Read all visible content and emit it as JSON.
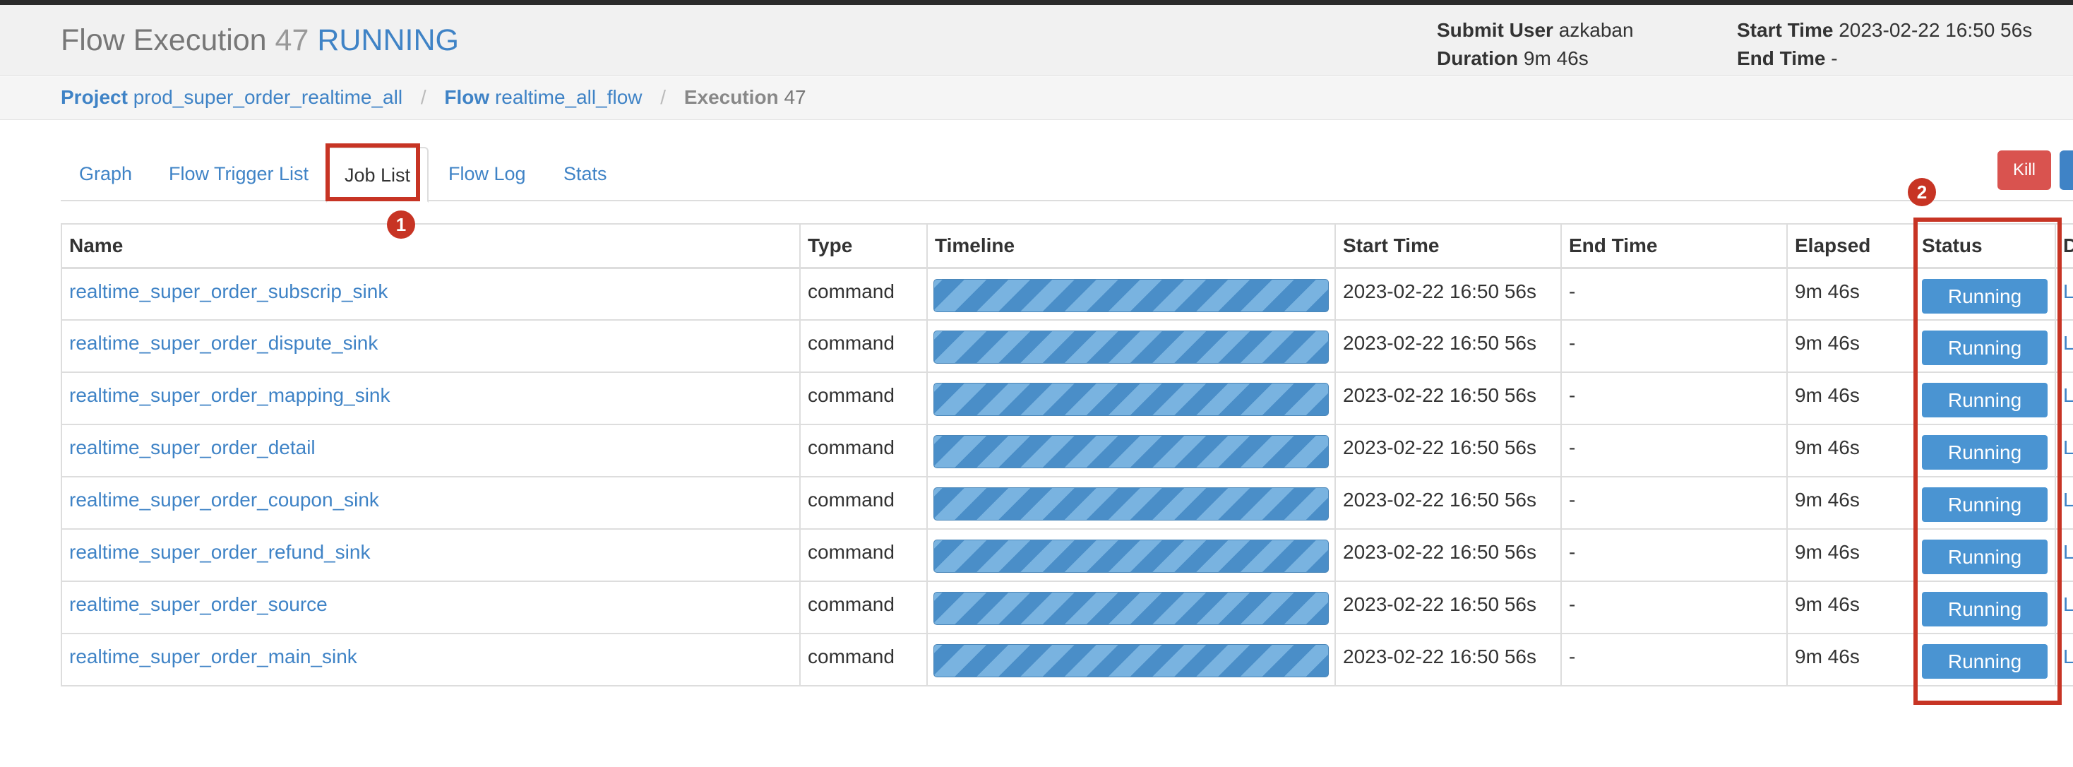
{
  "header": {
    "title": "Flow Execution",
    "exec_id": "47",
    "exec_status": "RUNNING",
    "submit_user_label": "Submit User",
    "submit_user": "azkaban",
    "duration_label": "Duration",
    "duration": "9m 46s",
    "start_time_label": "Start Time",
    "start_time": "2023-02-22 16:50 56s",
    "end_time_label": "End Time",
    "end_time": "-"
  },
  "breadcrumb": {
    "project_label": "Project",
    "project": "prod_super_order_realtime_all",
    "flow_label": "Flow",
    "flow": "realtime_all_flow",
    "execution_label": "Execution",
    "execution": "47"
  },
  "tabs": [
    {
      "label": "Graph"
    },
    {
      "label": "Flow Trigger List"
    },
    {
      "label": "Job List"
    },
    {
      "label": "Flow Log"
    },
    {
      "label": "Stats"
    }
  ],
  "active_tab": "Job List",
  "actions": {
    "kill_label": "Kill"
  },
  "annotations": {
    "first": "1",
    "second": "2"
  },
  "table": {
    "columns": [
      "Name",
      "Type",
      "Timeline",
      "Start Time",
      "End Time",
      "Elapsed",
      "Status",
      "D"
    ],
    "rows": [
      {
        "name": "realtime_super_order_subscrip_sink",
        "type": "command",
        "start": "2023-02-22 16:50 56s",
        "end": "-",
        "elapsed": "9m 46s",
        "status": "Running",
        "log": "L",
        "progress": 1.0
      },
      {
        "name": "realtime_super_order_dispute_sink",
        "type": "command",
        "start": "2023-02-22 16:50 56s",
        "end": "-",
        "elapsed": "9m 46s",
        "status": "Running",
        "log": "L",
        "progress": 1.0
      },
      {
        "name": "realtime_super_order_mapping_sink",
        "type": "command",
        "start": "2023-02-22 16:50 56s",
        "end": "-",
        "elapsed": "9m 46s",
        "status": "Running",
        "log": "L",
        "progress": 1.0
      },
      {
        "name": "realtime_super_order_detail",
        "type": "command",
        "start": "2023-02-22 16:50 56s",
        "end": "-",
        "elapsed": "9m 46s",
        "status": "Running",
        "log": "L",
        "progress": 1.0
      },
      {
        "name": "realtime_super_order_coupon_sink",
        "type": "command",
        "start": "2023-02-22 16:50 56s",
        "end": "-",
        "elapsed": "9m 46s",
        "status": "Running",
        "log": "L",
        "progress": 1.0
      },
      {
        "name": "realtime_super_order_refund_sink",
        "type": "command",
        "start": "2023-02-22 16:50 56s",
        "end": "-",
        "elapsed": "9m 46s",
        "status": "Running",
        "log": "L",
        "progress": 1.0
      },
      {
        "name": "realtime_super_order_source",
        "type": "command",
        "start": "2023-02-22 16:50 56s",
        "end": "-",
        "elapsed": "9m 46s",
        "status": "Running",
        "log": "L",
        "progress": 1.0
      },
      {
        "name": "realtime_super_order_main_sink",
        "type": "command",
        "start": "2023-02-22 16:50 56s",
        "end": "-",
        "elapsed": "9m 46s",
        "status": "Running",
        "log": "L",
        "progress": 1.0
      }
    ]
  },
  "colors": {
    "link": "#3f83c6",
    "status_running": "#4a94d2",
    "kill": "#d9534f",
    "annotation": "#c73424"
  }
}
